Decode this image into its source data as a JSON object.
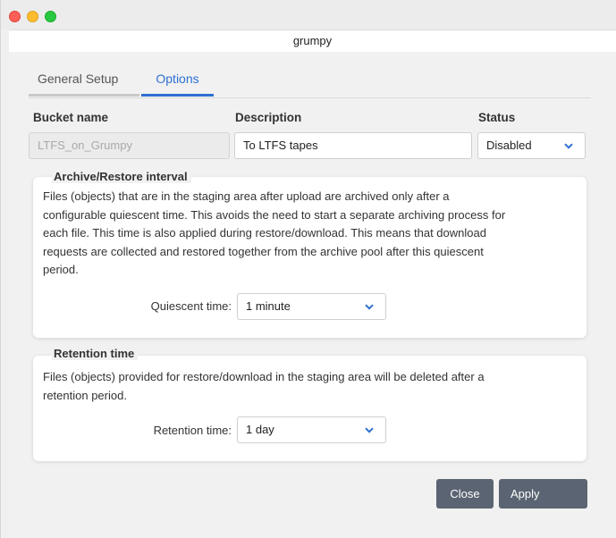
{
  "window": {
    "title": "grumpy"
  },
  "tabs": [
    {
      "label": "General Setup",
      "active": false
    },
    {
      "label": "Options",
      "active": true
    }
  ],
  "bucket": {
    "name_label": "Bucket name",
    "name_value": "LTFS_on_Grumpy",
    "description_label": "Description",
    "description_value": "To LTFS tapes",
    "status_label": "Status",
    "status_value": "Disabled"
  },
  "archive": {
    "title": "Archive/Restore interval",
    "lines": [
      "Files (objects) that are in the staging area after upload are archived only after a",
      "configurable quiescent time. This avoids the need to start a separate archiving process for",
      "each file. This time is also applied during restore/download. This means that download",
      "requests are collected and restored together from the archive pool after this quiescent",
      "period."
    ],
    "quiescent_label": "Quiescent time:",
    "quiescent_value": "1 minute"
  },
  "retention": {
    "title": "Retention time",
    "lines": [
      "Files (objects) provided for restore/download in the staging area will be deleted after a",
      "retention period."
    ],
    "retention_label": "Retention time:",
    "retention_value": "1 day"
  },
  "buttons": {
    "close": "Close",
    "apply": "Apply"
  },
  "colors": {
    "accent": "#2e6fd2",
    "button": "#5a6472"
  },
  "icons": {
    "select": "chevron-down-icon"
  }
}
